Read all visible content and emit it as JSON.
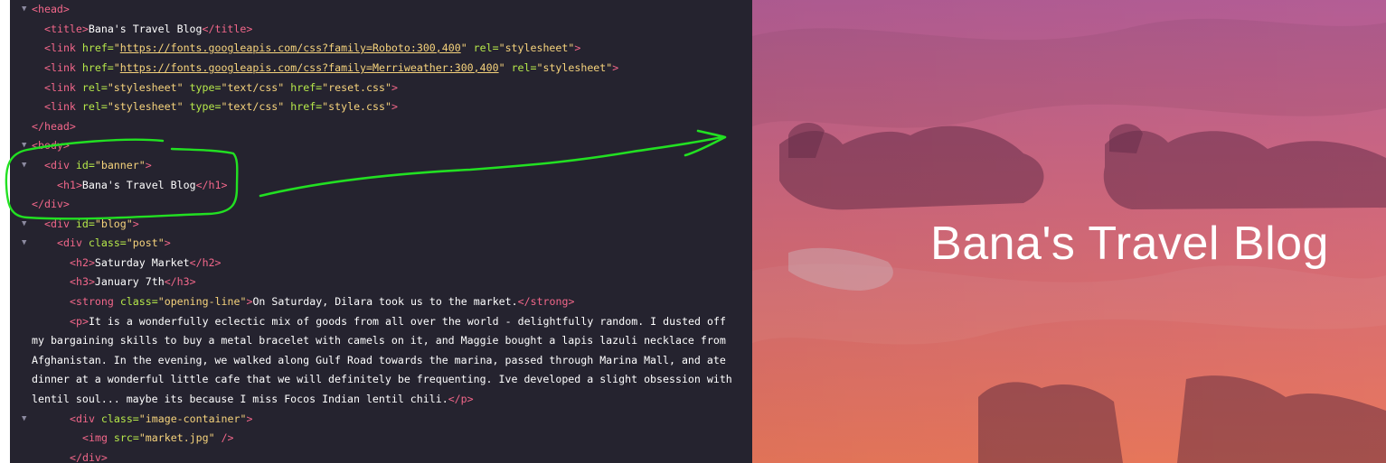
{
  "code": {
    "head_open": "<head>",
    "title_open": "<title>",
    "title_text": "Bana's Travel Blog",
    "title_close": "</title>",
    "link1_pre": "<link ",
    "link1_href_attr": "href=",
    "link1_href": "https://fonts.googleapis.com/css?family=Roboto:300,400",
    "link1_rel_attr": "rel=",
    "link1_rel": "\"stylesheet\"",
    "link2_href": "https://fonts.googleapis.com/css?family=Merriweather:300,400",
    "link3_rel": "\"stylesheet\"",
    "type_attr": "type=",
    "type_val": "\"text/css\"",
    "href_attr": "href=",
    "reset_css": "\"reset.css\"",
    "style_css": "\"style.css\"",
    "head_close": "</head>",
    "body_open": "<body>",
    "div_open": "<div ",
    "id_attr": "id=",
    "banner_id": "\"banner\"",
    "h1_open": "<h1>",
    "h1_text": "Bana's Travel Blog",
    "h1_close": "</h1>",
    "div_close": "</div>",
    "blog_id": "\"blog\"",
    "class_attr": "class=",
    "post_class": "\"post\"",
    "h2_open": "<h2>",
    "h2_text": "Saturday Market",
    "h2_close": "</h2>",
    "h3_open": "<h3>",
    "h3_text": "January 7th",
    "h3_close": "</h3>",
    "strong_open": "<strong ",
    "opening_line_class": "\"opening-line\"",
    "strong_text": "On Saturday, Dilara took us to the market.",
    "strong_close": "</strong>",
    "p_open": "<p>",
    "p_line1": "It is a wonderfully eclectic mix of goods from all over the world - delightfully random. I dusted off",
    "p_line2": "my bargaining skills to buy a metal bracelet with camels on it, and Maggie bought a lapis lazuli necklace from",
    "p_line3": "Afghanistan. In the evening, we walked along Gulf Road towards the marina, passed through Marina Mall, and ate",
    "p_line4": "dinner at a wonderful little cafe that we will definitely be frequenting. Ive developed a slight obsession with",
    "p_line5": "lentil soul... maybe its because I miss Focos Indian lentil chili.",
    "p_close": "</p>",
    "image_container_class": "\"image-container\"",
    "img_open": "<img ",
    "src_attr": "src=",
    "img_src": "\"market.jpg\"",
    "img_end": " />",
    "tag_end": ">",
    "tag_end_gt": ">"
  },
  "preview": {
    "banner_title": "Bana's Travel Blog"
  },
  "colors": {
    "editor_bg": "#25232f",
    "tag": "#f2678a",
    "attr": "#b6e84a",
    "string": "#f6d37c",
    "annotation": "#22e022",
    "overlay_top": "#b25a93",
    "overlay_bottom": "#ef7a5c"
  }
}
